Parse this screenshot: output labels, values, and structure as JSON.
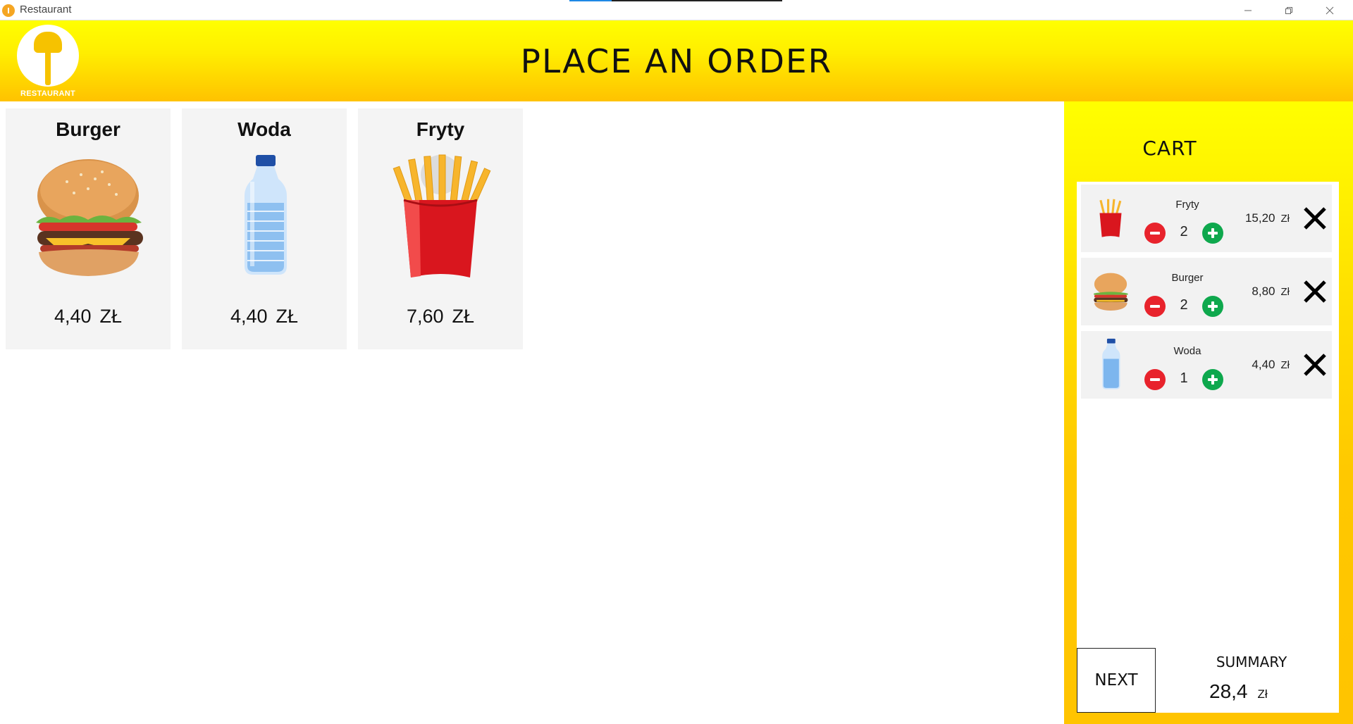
{
  "window": {
    "title": "Restaurant",
    "controls": [
      "minimize",
      "maximize",
      "close"
    ]
  },
  "header": {
    "logo_text": "RESTAURANT",
    "title": "PLACE AN ORDER",
    "gradient_top": "#ffff00",
    "gradient_bottom": "#ffc200"
  },
  "products": [
    {
      "name": "Burger",
      "price": "4,40",
      "currency": "ZŁ",
      "icon": "burger-icon"
    },
    {
      "name": "Woda",
      "price": "4,40",
      "currency": "ZŁ",
      "icon": "water-bottle-icon"
    },
    {
      "name": "Fryty",
      "price": "7,60",
      "currency": "ZŁ",
      "icon": "fries-icon"
    }
  ],
  "cart": {
    "title": "CART",
    "items": [
      {
        "name": "Fryty",
        "qty": "2",
        "price": "15,20",
        "currency": "Zł",
        "icon": "fries-icon"
      },
      {
        "name": "Burger",
        "qty": "2",
        "price": "8,80",
        "currency": "Zł",
        "icon": "burger-icon"
      },
      {
        "name": "Woda",
        "qty": "1",
        "price": "4,40",
        "currency": "Zł",
        "icon": "water-bottle-icon"
      }
    ],
    "next_label": "NEXT",
    "summary_label": "SUMMARY",
    "total": "28,4",
    "total_currency": "Zł"
  },
  "colors": {
    "minus": "#e8232c",
    "plus": "#0ea84d",
    "card_bg": "#f4f4f4"
  }
}
